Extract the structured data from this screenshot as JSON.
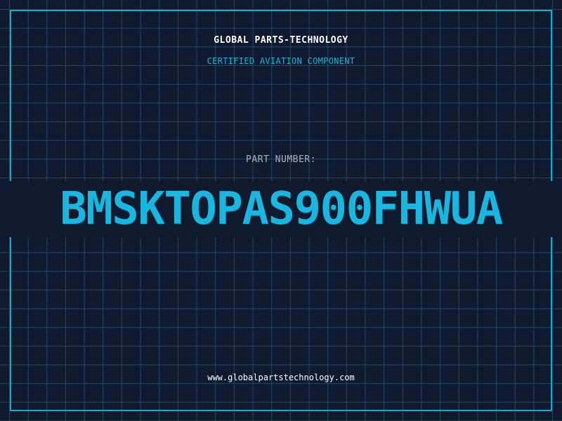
{
  "header": {
    "company": "GLOBAL PARTS-TECHNOLOGY",
    "subtitle": "CERTIFIED AVIATION COMPONENT"
  },
  "part": {
    "label": "PART NUMBER:",
    "number": "BMSKTOPAS900FHWUA"
  },
  "footer": {
    "website": "www.globalpartstechnology.com"
  },
  "colors": {
    "background": "#0f1a2e",
    "grid": "#1e4a5e",
    "accent": "#17a8d4",
    "text": "#ffffff",
    "muted": "#a9b4c2"
  }
}
